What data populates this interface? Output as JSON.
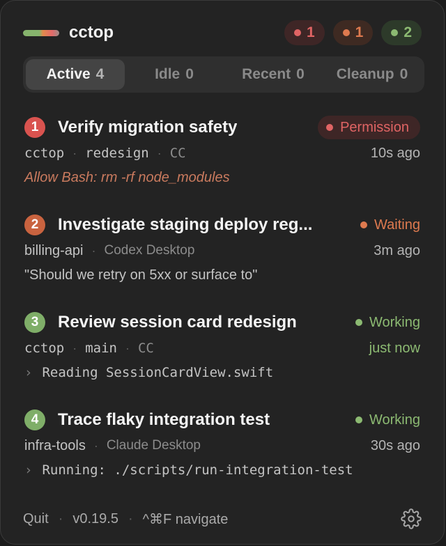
{
  "app": {
    "title": "cctop"
  },
  "badges": [
    {
      "count": "1",
      "color": "#e06464"
    },
    {
      "count": "1",
      "color": "#de7a4f"
    },
    {
      "count": "2",
      "color": "#8cba72"
    }
  ],
  "tabs": [
    {
      "label": "Active",
      "count": "4",
      "active": true
    },
    {
      "label": "Idle",
      "count": "0"
    },
    {
      "label": "Recent",
      "count": "0"
    },
    {
      "label": "Cleanup",
      "count": "0"
    }
  ],
  "sessions": [
    {
      "index": "1",
      "title": "Verify migration safety",
      "status": "Permission",
      "status_color": "#e06464",
      "project": "cctop",
      "branch": "redesign",
      "client": "CC",
      "time": "10s ago",
      "detail": "Allow Bash: rm -rf node_modules"
    },
    {
      "index": "2",
      "title": "Investigate staging deploy reg...",
      "status": "Waiting",
      "status_color": "#de7a4f",
      "project": "billing-api",
      "client": "Codex Desktop",
      "time": "3m ago",
      "detail": "\"Should we retry on 5xx or surface to\""
    },
    {
      "index": "3",
      "title": "Review session card redesign",
      "status": "Working",
      "status_color": "#8cba72",
      "project": "cctop",
      "branch": "main",
      "client": "CC",
      "time": "just now",
      "detail_prefix": "›",
      "detail": "Reading SessionCardView.swift"
    },
    {
      "index": "4",
      "title": "Trace flaky integration test",
      "status": "Working",
      "status_color": "#8cba72",
      "project": "infra-tools",
      "client": "Claude Desktop",
      "time": "30s ago",
      "detail_prefix": "›",
      "detail": "Running: ./scripts/run-integration-test"
    }
  ],
  "footer": {
    "quit": "Quit",
    "version": "v0.19.5",
    "shortcut": "^⌘F navigate",
    "separator": "·",
    "settings_icon": "gear-icon"
  }
}
